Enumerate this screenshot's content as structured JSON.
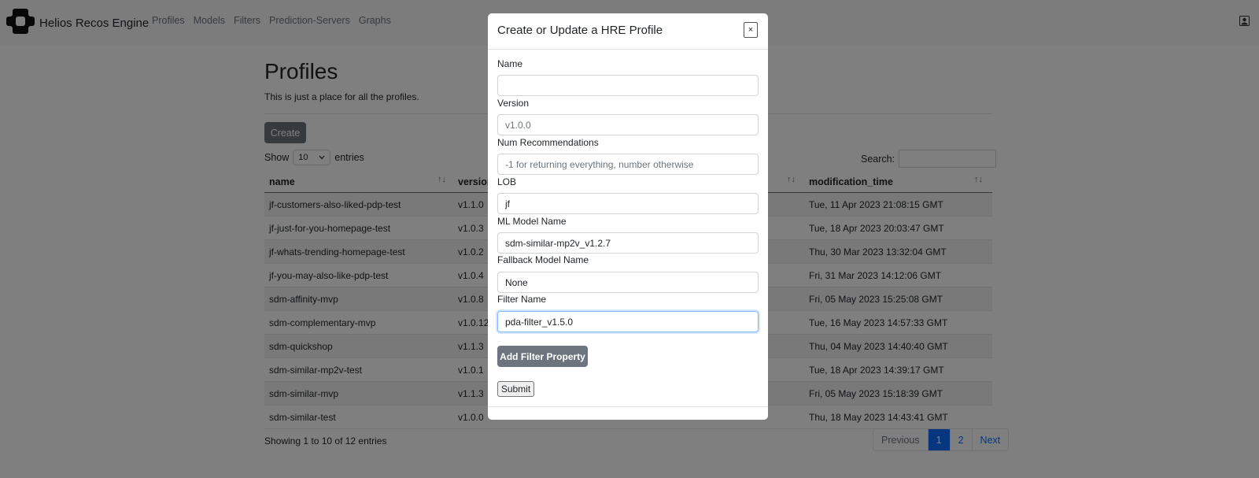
{
  "app": {
    "brand": "Helios Recos Engine",
    "nav": [
      "Profiles",
      "Models",
      "Filters",
      "Prediction-Servers",
      "Graphs"
    ],
    "icons": {
      "logo": "helios-logo-icon",
      "user": "user-icon"
    }
  },
  "page": {
    "title": "Profiles",
    "subtitle": "This is just a place for all the profiles.",
    "create_label": "Create",
    "show_label": "Show",
    "entries_value": "10",
    "entries_label": "entries",
    "search_label": "Search:",
    "columns": [
      "name",
      "version",
      "modification_time"
    ],
    "rows": [
      {
        "name": "jf-customers-also-liked-pdp-test",
        "version": "v1.1.0",
        "modified": "Tue, 11 Apr 2023 21:08:15 GMT"
      },
      {
        "name": "jf-just-for-you-homepage-test",
        "version": "v1.0.3",
        "modified": "Tue, 18 Apr 2023 20:03:47 GMT"
      },
      {
        "name": "jf-whats-trending-homepage-test",
        "version": "v1.0.2",
        "modified": "Thu, 30 Mar 2023 13:32:04 GMT"
      },
      {
        "name": "jf-you-may-also-like-pdp-test",
        "version": "v1.0.4",
        "modified": "Fri, 31 Mar 2023 14:12:06 GMT"
      },
      {
        "name": "sdm-affinity-mvp",
        "version": "v1.0.8",
        "modified": "Fri, 05 May 2023 15:25:08 GMT"
      },
      {
        "name": "sdm-complementary-mvp",
        "version": "v1.0.12",
        "modified": "Tue, 16 May 2023 14:57:33 GMT"
      },
      {
        "name": "sdm-quickshop",
        "version": "v1.1.3",
        "modified": "Thu, 04 May 2023 14:40:40 GMT"
      },
      {
        "name": "sdm-similar-mp2v-test",
        "version": "v1.0.1",
        "modified": "Tue, 18 Apr 2023 14:39:17 GMT"
      },
      {
        "name": "sdm-similar-mvp",
        "version": "v1.1.3",
        "modified": "Fri, 05 May 2023 15:18:39 GMT"
      },
      {
        "name": "sdm-similar-test",
        "version": "v1.0.0",
        "modified": "Thu, 18 May 2023 14:43:41 GMT"
      }
    ],
    "showing": "Showing 1 to 10 of 12 entries",
    "pagination": [
      "Previous",
      "1",
      "2",
      "Next"
    ],
    "active_page": "1"
  },
  "modal": {
    "title": "Create or Update a HRE Profile",
    "close": "×",
    "fields": [
      {
        "label": "Name",
        "value": "",
        "placeholder": ""
      },
      {
        "label": "Version",
        "value": "",
        "placeholder": "v1.0.0"
      },
      {
        "label": "Num Recommendations",
        "value": "",
        "placeholder": "-1 for returning everything, number otherwise"
      },
      {
        "label": "LOB",
        "value": "jf",
        "placeholder": ""
      },
      {
        "label": "ML Model Name",
        "value": "sdm-similar-mp2v_v1.2.7",
        "placeholder": ""
      },
      {
        "label": "Fallback Model Name",
        "value": "None",
        "placeholder": ""
      },
      {
        "label": "Filter Name",
        "value": "pda-filter_v1.5.0",
        "placeholder": ""
      }
    ],
    "add_filter_label": "Add Filter Property",
    "submit_label": "Submit"
  },
  "colors": {
    "primary": "#0d6efd",
    "secondary": "#6c757d",
    "focus_ring": "#86b7fe"
  }
}
